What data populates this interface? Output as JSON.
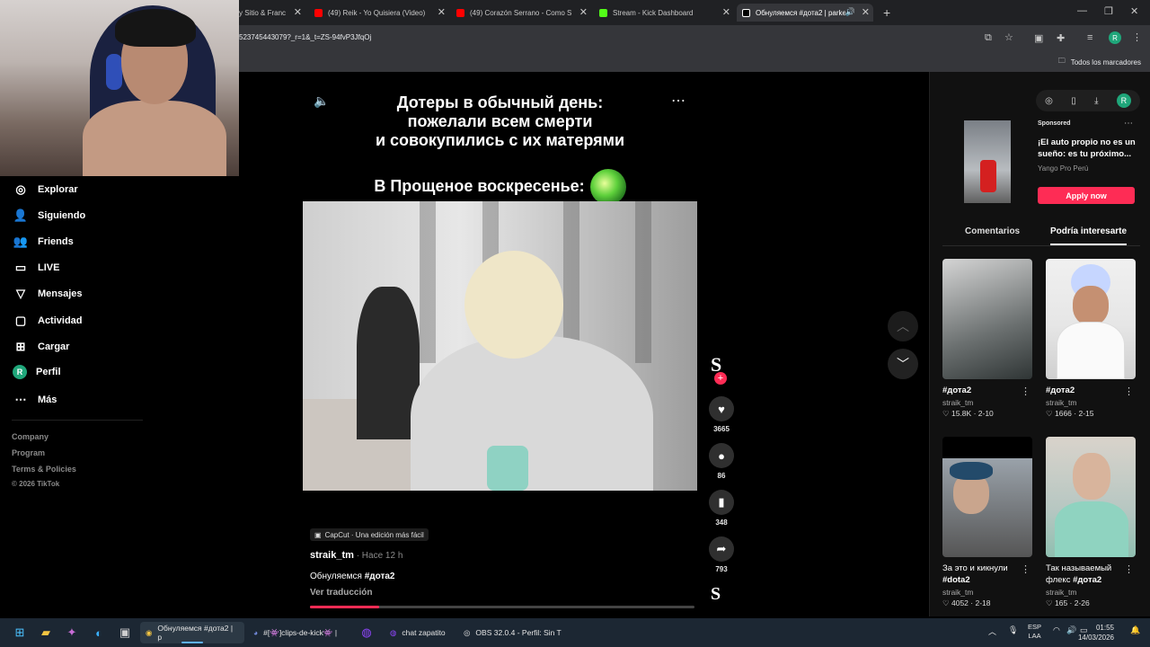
{
  "browser": {
    "tabs": [
      {
        "title": "y Sitio & Franc",
        "icon": "web-icon",
        "color": "#888888"
      },
      {
        "title": "(49) Reik - Yo Quisiera (Video)",
        "icon": "youtube-icon",
        "color": "#ff0000"
      },
      {
        "title": "(49) Corazón Serrano - Como S",
        "icon": "youtube-icon",
        "color": "#ff0000"
      },
      {
        "title": "Stream - Kick Dashboard",
        "icon": "kick-icon",
        "color": "#53fc18"
      },
      {
        "title": "Обнуляемся #дота2 | parke",
        "icon": "tiktok-icon",
        "color": "#ffffff",
        "active": true
      }
    ],
    "url": "523745443079?_r=1&_t=ZS-94fvP3JfqOj",
    "bookmarks_all": "Todos los marcadores",
    "profile_initial": "R"
  },
  "nav": {
    "items": [
      {
        "label": "Explorar",
        "icon": "compass-icon"
      },
      {
        "label": "Siguiendo",
        "icon": "following-icon"
      },
      {
        "label": "Friends",
        "icon": "friends-icon"
      },
      {
        "label": "LIVE",
        "icon": "live-icon"
      },
      {
        "label": "Mensajes",
        "icon": "messages-icon"
      },
      {
        "label": "Actividad",
        "icon": "activity-icon"
      },
      {
        "label": "Cargar",
        "icon": "upload-icon"
      },
      {
        "label": "Perfil",
        "icon": "profile-icon"
      },
      {
        "label": "Más",
        "icon": "more-icon"
      }
    ],
    "footer": {
      "company": "Company",
      "program": "Program",
      "terms": "Terms & Policies",
      "copyright": "© 2026 TikTok"
    }
  },
  "video": {
    "caption_line1": "Дотеры в обычный день:",
    "caption_line2": "пожелали всем смерти",
    "caption_line3": "и совокупились с их матерями",
    "caption_line4": "В Прощеное воскресенье:",
    "capcut": "CapCut · Una edición más fácil",
    "author": "straik_tm",
    "time": " · Hace 12 h",
    "description": "Обнуляемся ",
    "hashtag": "#дота2",
    "translate": "Ver traducción",
    "progress": 0.18,
    "actions": {
      "likes": "3665",
      "comments": "86",
      "saves": "348",
      "shares": "793"
    },
    "logo_letter": "S"
  },
  "ad": {
    "sponsored": "Sponsored",
    "title": "¡El auto propio no es un sueño: es tu próximo...",
    "brand": "Yango Pro Perú",
    "cta": "Apply now"
  },
  "right_tabs": {
    "comments": "Comentarios",
    "interest": "Podría interesarte"
  },
  "cards": [
    {
      "title_text": "",
      "tag": "#дота2",
      "author": "straik_tm",
      "likes": "15.8K",
      "date": "2-10"
    },
    {
      "title_text": "",
      "tag": "#дота2",
      "author": "straik_tm",
      "likes": "1666",
      "date": "2-15"
    },
    {
      "title_text": "За это и кикнули ",
      "tag": "#dota2",
      "author": "straik_tm",
      "likes": "4052",
      "date": "2-18"
    },
    {
      "title_text": "Так называемый флекс ",
      "tag": "#дота2",
      "author": "straik_tm",
      "likes": "165",
      "date": "2-26"
    }
  ],
  "taskbar": {
    "tasks": [
      {
        "label": "Обнуляемся #дота2 | p",
        "icon": "chrome-icon",
        "active": true
      },
      {
        "label": "#[👾]clips-de-kick👾 |",
        "icon": "discord-icon"
      },
      {
        "label": "chat zapatito",
        "icon": "twitch-icon"
      },
      {
        "label": "OBS 32.0.4 - Perfil: Sin T",
        "icon": "obs-icon"
      }
    ],
    "lang": "ESP",
    "lang2": "LAA",
    "time": "01:55",
    "date": "14/03/2026"
  }
}
